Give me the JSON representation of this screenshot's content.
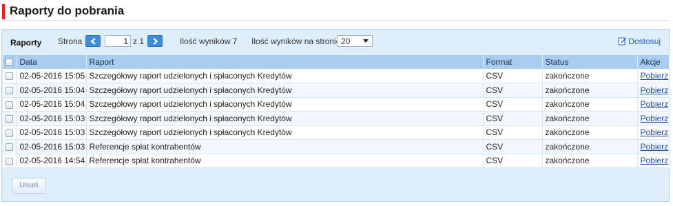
{
  "header": {
    "title": "Raporty do pobrania",
    "accent_color": "#e3201b"
  },
  "toolbar": {
    "section_label": "Raporty",
    "page_label": "Strona",
    "page_value": "1",
    "page_of": "z 1",
    "results_count": "Ilość wyników 7",
    "per_page_label": "Ilość wyników na stronie",
    "per_page_value": "20",
    "customize_label": "Dostosuj",
    "prev_icon": "chevron-left-icon",
    "next_icon": "chevron-right-icon"
  },
  "table": {
    "columns": [
      "Data",
      "Raport",
      "Format",
      "Status",
      "Akcje"
    ],
    "rows": [
      {
        "date": "02-05-2016 15:05",
        "report": "Szczegółowy raport udzielonych i spłaconych Kredytów",
        "format": "CSV",
        "status": "zakończone",
        "action": "Pobierz"
      },
      {
        "date": "02-05-2016 15:04",
        "report": "Szczegółowy raport udzielonych i spłaconych Kredytów",
        "format": "CSV",
        "status": "zakończone",
        "action": "Pobierz"
      },
      {
        "date": "02-05-2016 15:04",
        "report": "Szczegółowy raport udzielonych i spłaconych Kredytów",
        "format": "CSV",
        "status": "zakończone",
        "action": "Pobierz"
      },
      {
        "date": "02-05-2016 15:03",
        "report": "Szczegółowy raport udzielonych i spłaconych Kredytów",
        "format": "CSV",
        "status": "zakończone",
        "action": "Pobierz"
      },
      {
        "date": "02-05-2016 15:03",
        "report": "Szczegółowy raport udzielonych i spłaconych Kredytów",
        "format": "CSV",
        "status": "zakończone",
        "action": "Pobierz"
      },
      {
        "date": "02-05-2016 15:03",
        "report": "Referencje spłat kontrahentów",
        "format": "CSV",
        "status": "zakończone",
        "action": "Pobierz"
      },
      {
        "date": "02-05-2016 14:54",
        "report": "Referencje spłat kontrahentów",
        "format": "CSV",
        "status": "zakończone",
        "action": "Pobierz"
      }
    ]
  },
  "footer": {
    "delete_label": "Usuń"
  },
  "colors": {
    "panel_bg": "#dfeefb",
    "header_row": "#a9cdef",
    "nav_button": "#3d8bd9",
    "link": "#1f4fa8"
  }
}
